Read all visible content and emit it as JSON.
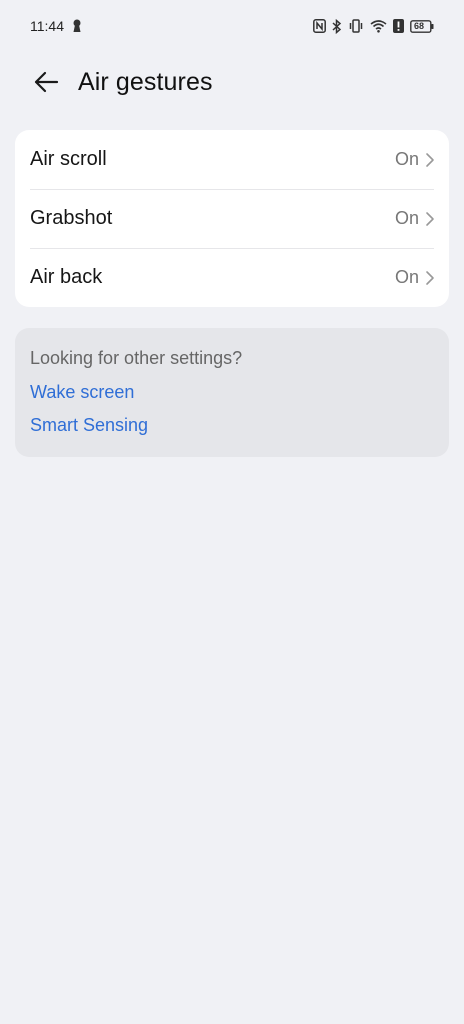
{
  "status_bar": {
    "time": "11:44",
    "battery": "68",
    "icons": [
      "nfc-icon",
      "bluetooth-icon",
      "vibrate-icon",
      "wifi-icon",
      "alert-icon",
      "battery-icon"
    ]
  },
  "header": {
    "back_icon": "arrow-left-icon",
    "title": "Air gestures"
  },
  "settings": [
    {
      "label": "Air scroll",
      "value": "On"
    },
    {
      "label": "Grabshot",
      "value": "On"
    },
    {
      "label": "Air back",
      "value": "On"
    }
  ],
  "other": {
    "title": "Looking for other settings?",
    "links": [
      "Wake screen",
      "Smart Sensing"
    ]
  },
  "colors": {
    "background": "#f0f1f5",
    "card": "#ffffff",
    "link": "#2f6ed6"
  }
}
